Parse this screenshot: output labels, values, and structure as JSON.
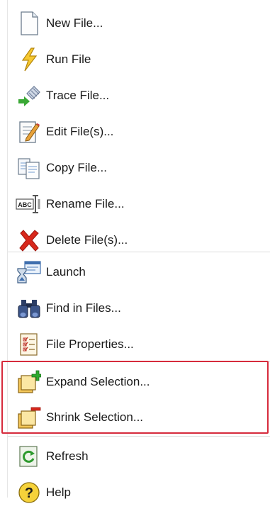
{
  "menu": {
    "items": [
      {
        "label": "New File...",
        "icon": "new-file-icon"
      },
      {
        "label": "Run File",
        "icon": "run-lightning-icon"
      },
      {
        "label": "Trace File...",
        "icon": "trace-icon"
      },
      {
        "label": "Edit File(s)...",
        "icon": "edit-pencil-icon"
      },
      {
        "label": "Copy File...",
        "icon": "copy-icon"
      },
      {
        "label": "Rename File...",
        "icon": "rename-abc-icon"
      },
      {
        "label": "Delete File(s)...",
        "icon": "delete-x-icon"
      },
      {
        "label": "Launch",
        "icon": "launch-icon"
      },
      {
        "label": "Find in Files...",
        "icon": "binoculars-icon"
      },
      {
        "label": "File Properties...",
        "icon": "properties-icon"
      },
      {
        "label": "Expand Selection...",
        "icon": "expand-selection-icon"
      },
      {
        "label": "Shrink Selection...",
        "icon": "shrink-selection-icon"
      },
      {
        "label": "Refresh",
        "icon": "refresh-icon"
      },
      {
        "label": "Help",
        "icon": "help-icon"
      }
    ]
  },
  "colors": {
    "highlight": "#d62b3c",
    "separator": "#dcdcdc",
    "text": "#1a1a1a"
  }
}
